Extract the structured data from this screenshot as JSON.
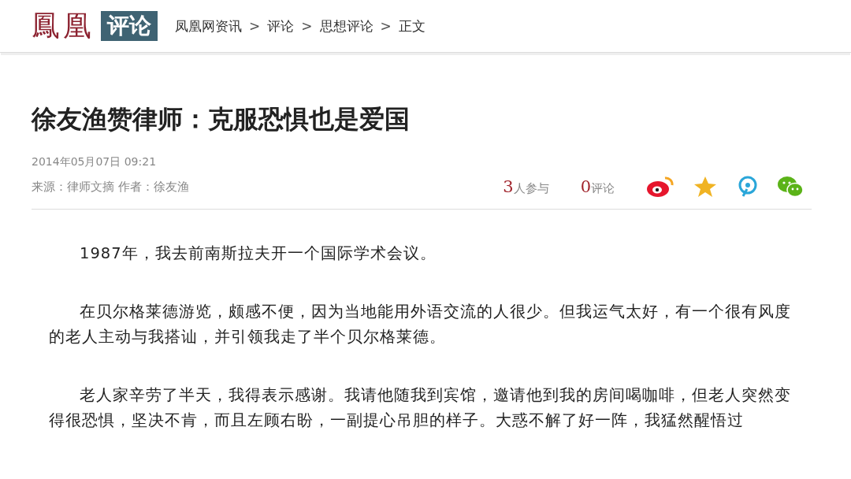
{
  "header": {
    "logo": {
      "brand": "鳳凰",
      "section": "评论"
    },
    "breadcrumb": [
      "凤凰网资讯",
      "评论",
      "思想评论",
      "正文"
    ],
    "separator": ">"
  },
  "article": {
    "title": "徐友渔赞律师：克服恐惧也是爱国",
    "datetime": "2014年05月07日  09:21",
    "source": "来源：律师文摘  作者：徐友渔",
    "stats": [
      {
        "count": "3",
        "label": "人参与"
      },
      {
        "count": "0",
        "label": "评论"
      }
    ],
    "share": [
      {
        "kind": "weibo"
      },
      {
        "kind": "qzone"
      },
      {
        "kind": "tencent"
      },
      {
        "kind": "wechat"
      }
    ],
    "paragraphs": [
      "1987年，我去前南斯拉夫开一个国际学术会议。",
      "在贝尔格莱德游览，颇感不便，因为当地能用外语交流的人很少。但我运气太好，有一个很有风度的老人主动与我搭讪，并引领我走了半个贝尔格莱德。",
      "老人家辛劳了半天，我得表示感谢。我请他随我到宾馆，邀请他到我的房间喝咖啡，但老人突然变得很恐惧，坚决不肯，而且左顾右盼，一副提心吊胆的样子。大惑不解了好一阵，我猛然醒悟过"
    ]
  }
}
